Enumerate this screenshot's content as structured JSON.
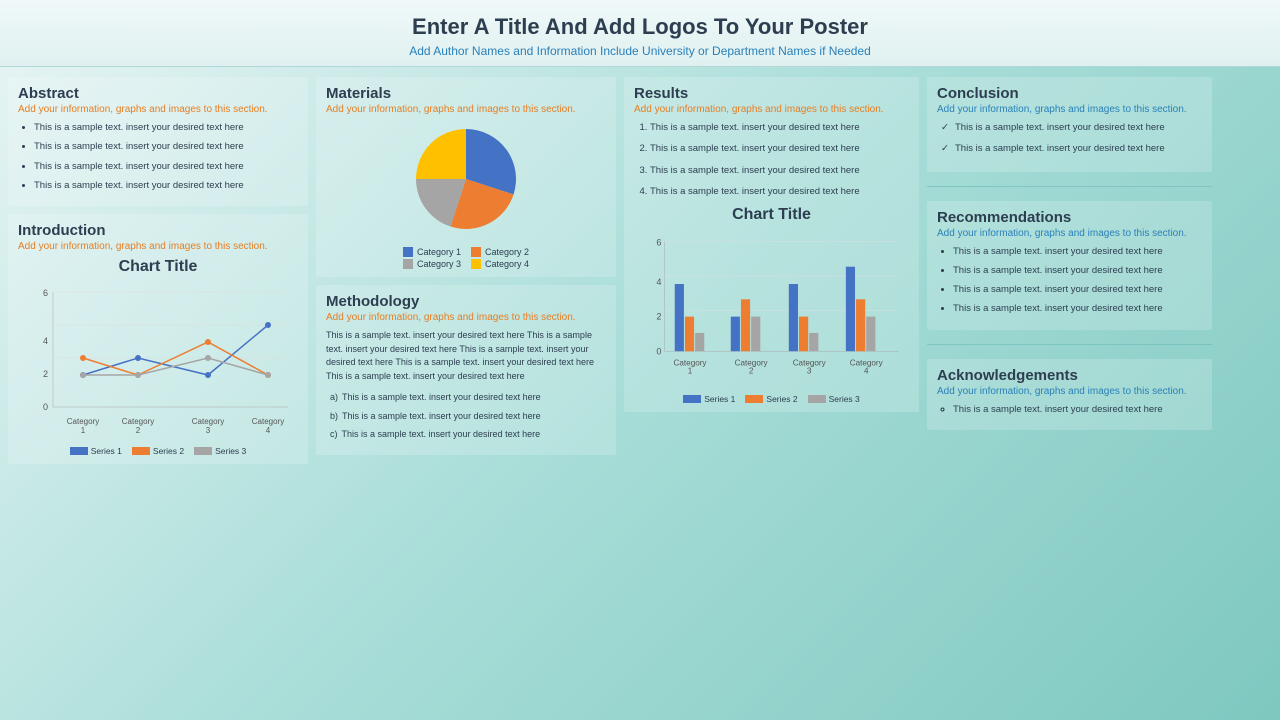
{
  "header": {
    "title": "Enter A Title And Add Logos To Your Poster",
    "subtitle": "Add Author Names and Information Include University or Department Names if Needed"
  },
  "abstract": {
    "title": "Abstract",
    "subtitle": "Add your information, graphs and images to this section.",
    "items": [
      "This is a sample text. insert your desired text here",
      "This is a sample text. insert your desired text here",
      "This is a sample text. insert your desired text here",
      "This is a sample text. insert your desired text here"
    ]
  },
  "introduction": {
    "title": "Introduction",
    "subtitle": "Add your information, graphs and images to this section.",
    "chart_title": "Chart Title",
    "x_labels": [
      "Category 1",
      "Category 2",
      "Category 3",
      "Category 4"
    ],
    "y_labels": [
      "0",
      "2",
      "4",
      "6"
    ],
    "series": [
      {
        "name": "Series 1",
        "color": "#4472C4"
      },
      {
        "name": "Series 2",
        "color": "#ED7D31"
      },
      {
        "name": "Series 3",
        "color": "#A5A5A5"
      }
    ]
  },
  "materials": {
    "title": "Materials",
    "subtitle": "Add your information, graphs and images to this section.",
    "pie": {
      "categories": [
        "Category 1",
        "Category 2",
        "Category 3",
        "Category 4"
      ],
      "colors": [
        "#4472C4",
        "#ED7D31",
        "#A5A5A5",
        "#FFC000"
      ],
      "values": [
        30,
        25,
        20,
        25
      ]
    }
  },
  "methodology": {
    "title": "Methodology",
    "subtitle": "Add your information, graphs and images to this section.",
    "body_text": "This is a sample text. insert your desired text here This is a sample text. insert your desired text here This is a sample text. insert your desired text here This is a sample text. insert your desired text here This is a sample text. insert your desired text here",
    "items": [
      "This is a sample text. insert your desired text here",
      "This is a sample text. insert your desired text here",
      "This is a sample text. insert your desired text here"
    ]
  },
  "results": {
    "title": "Results",
    "subtitle": "Add your information, graphs and images to this section.",
    "items": [
      "This is a sample text. insert your desired text here",
      "This is a sample text. insert your desired text here",
      "This is a sample text. insert your desired text here",
      "This is a sample text. insert your desired text here"
    ],
    "chart_title": "Chart Title",
    "x_labels": [
      "Category 1",
      "Category 2",
      "Category 3",
      "Category 4"
    ],
    "y_labels": [
      "0",
      "2",
      "4",
      "6"
    ],
    "series": [
      {
        "name": "Series 1",
        "color": "#4472C4"
      },
      {
        "name": "Series 2",
        "color": "#ED7D31"
      },
      {
        "name": "Series 3",
        "color": "#A5A5A5"
      }
    ]
  },
  "conclusion": {
    "title": "Conclusion",
    "subtitle": "Add your information, graphs and images to this section.",
    "items": [
      "This is a sample text. insert your desired text here",
      "This is a sample text. insert your desired text here"
    ]
  },
  "recommendations": {
    "title": "Recommendations",
    "subtitle": "Add your information, graphs and images to this section.",
    "items": [
      "This is a sample text. insert your desired text here",
      "This is a sample text. insert your desired text here",
      "This is a sample text. insert your desired text here",
      "This is a sample text. insert your desired text here"
    ]
  },
  "acknowledgements": {
    "title": "Acknowledgements",
    "subtitle": "Add your information, graphs and images to this section.",
    "items": [
      "This is a sample text. insert your desired text here"
    ]
  }
}
